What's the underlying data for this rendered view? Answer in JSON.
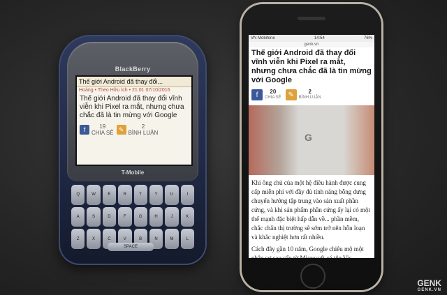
{
  "blackberry": {
    "brand": "BlackBerry",
    "carrier": "T-Mobile",
    "screen": {
      "headline": "Thế giới Android đã thay đổi...",
      "meta": "Hoàng • Theo Hữu Ích • 21:01 07/10/2016",
      "body": "Thế giới Android đã thay đổi vĩnh viễn khi Pixel ra mắt, nhưng chưa chắc đã là tin mừng với Google",
      "shares": "19",
      "shares_label": "CHIA SẺ",
      "comments": "2",
      "comments_label": "BÌNH LUẬN"
    },
    "space_key": "SPACE",
    "keys": [
      "Q",
      "W",
      "E",
      "R",
      "T",
      "Y",
      "U",
      "I",
      "A",
      "S",
      "D",
      "F",
      "G",
      "H",
      "J",
      "K",
      "Z",
      "X",
      "C",
      "V",
      "B",
      "N",
      "M",
      "L"
    ]
  },
  "iphone": {
    "status": {
      "carrier": "VN Mobifone",
      "time": "14:54",
      "battery": "76%"
    },
    "url": "genk.vn",
    "title": "Thế giới Android đã thay đổi vĩnh viễn khi Pixel ra mắt, nhưng chưa chắc đã là tin mừng với Google",
    "shares": "20",
    "shares_label": "CHIA SẺ",
    "comments": "2",
    "comments_label": "BÌNH LUẬN",
    "photo_glyph": "G",
    "body_1": "Khi ông chủ của một hệ điều hành được cung cấp miễn phí với đầy đủ tính năng bỗng dưng chuyển hướng tập trung vào sản xuất phần cứng, và khi sản phẩm phần cứng ấy lại có một thế mạnh đặc biệt hấp dẫn về... phần mềm, chắc chắn thị trường sẽ sớm trở nên hỗn loạn và khắc nghiệt hơn rất nhiều.",
    "body_2": "Cách đây gần 10 năm, Google chiêu mộ một nhân sự cao cấp từ Microsoft có tên Vic"
  },
  "watermark": {
    "brand": "GENK",
    "site": "GENK.VN"
  },
  "colors": {
    "facebook": "#3b5998",
    "comment": "#e0a13a"
  }
}
